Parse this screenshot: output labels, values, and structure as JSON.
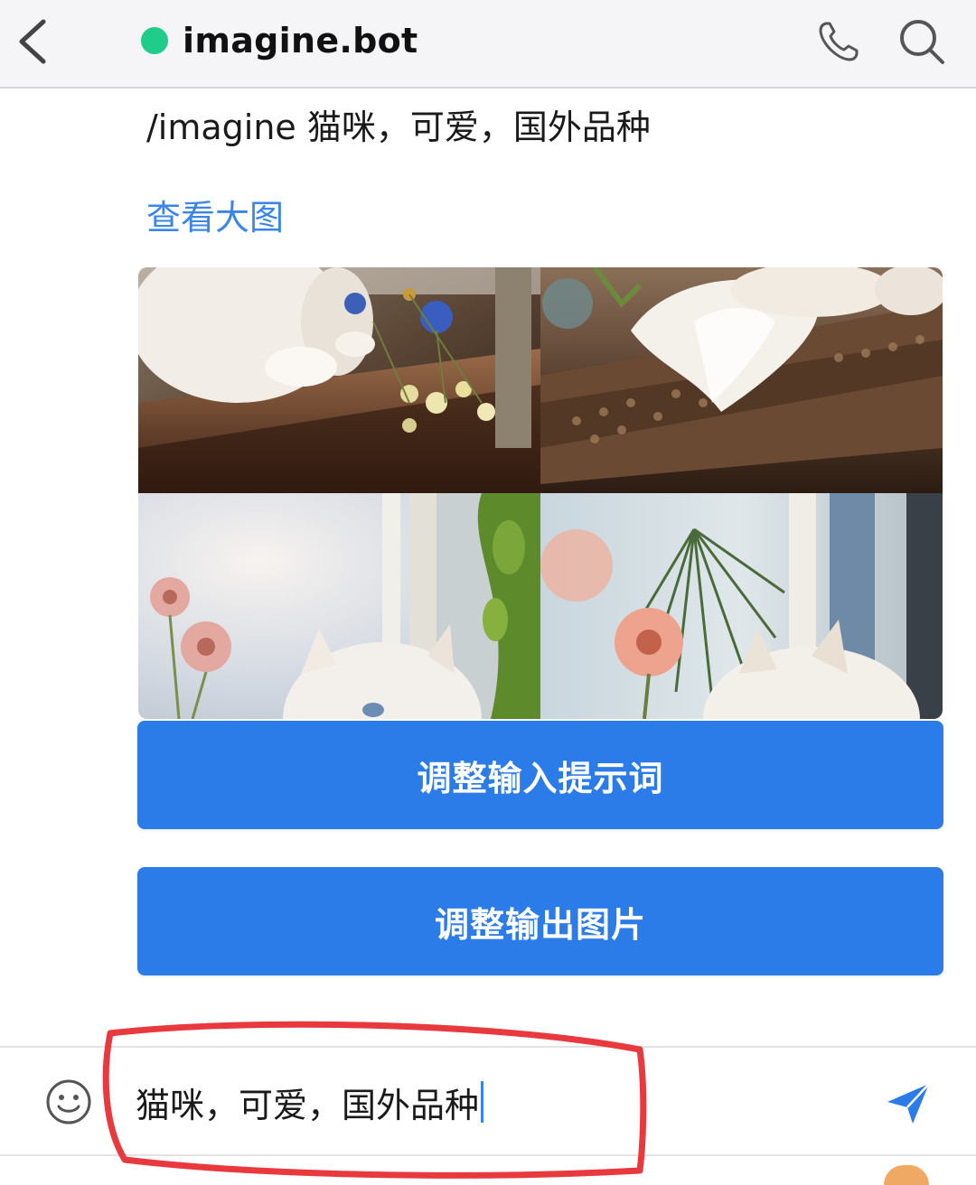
{
  "header": {
    "title": "imagine.bot",
    "status": "online",
    "icons": {
      "back": "chevron-left-icon",
      "phone": "phone-icon",
      "search": "search-icon"
    }
  },
  "message": {
    "prompt": "/imagine 猫咪，可爱，国外品种",
    "view_large_link": "查看大图",
    "image_grid": [
      "cat-photo-1",
      "cat-photo-2",
      "cat-photo-3",
      "cat-photo-4"
    ],
    "buttons": [
      "调整输入提示词",
      "调整输出图片"
    ]
  },
  "input_bar": {
    "value": "猫咪，可爱，国外品种",
    "icons": {
      "emoji": "smiley-icon",
      "send": "send-icon"
    }
  },
  "colors": {
    "accent": "#2b7be8",
    "link": "#3a86e8",
    "online": "#1fcc8a",
    "highlight": "#e8393f"
  }
}
